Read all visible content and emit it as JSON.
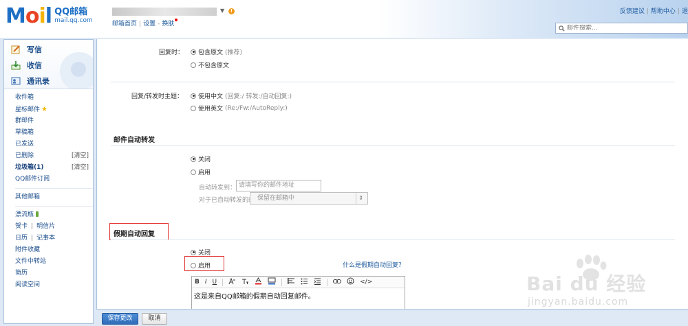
{
  "brand": {
    "logo": "MOil",
    "name_cn": "QQ邮箱",
    "domain": "mail.qq.com"
  },
  "header": {
    "nav": [
      "邮箱首页",
      "设置",
      "换肤"
    ],
    "right_links": [
      "反馈建议",
      "帮助中心",
      "退"
    ],
    "search_placeholder": "邮件搜索..."
  },
  "sidebar": {
    "actions": [
      {
        "label": "写信",
        "icon": "pencil-icon"
      },
      {
        "label": "收信",
        "icon": "inbox-download-icon"
      },
      {
        "label": "通讯录",
        "icon": "contacts-icon"
      }
    ],
    "folders": {
      "inbox": "收件箱",
      "starred": "星标邮件",
      "group": "群邮件",
      "drafts": "草稿箱",
      "sent": "已发送",
      "deleted": "已删除",
      "deleted_clear": "[清空]",
      "spam": "垃圾箱(1)",
      "spam_clear": "[清空]",
      "subscriptions": "QQ邮件订阅",
      "other": "其他邮箱",
      "drift_bottle": "漂流瓶",
      "card": "贺卡",
      "postcard": "明信片",
      "calendar": "日历",
      "notebook": "记事本",
      "attachments": "附件收藏",
      "transfer": "文件中转站",
      "resume": "简历",
      "reading": "阅读空间"
    }
  },
  "settings": {
    "reply": {
      "label": "回复时：",
      "options": [
        {
          "label": "包含原文",
          "hint": "(推荐)",
          "selected": true
        },
        {
          "label": "不包含原文",
          "hint": "",
          "selected": false
        }
      ]
    },
    "reply_subject": {
      "label": "回复/转发时主题：",
      "options": [
        {
          "label": "使用中文",
          "hint": "(回复:/ 转发:/自动回复:)",
          "selected": true
        },
        {
          "label": "使用英文",
          "hint": "(Re:/Fw:/AutoReply:)",
          "selected": false
        }
      ]
    },
    "auto_forward": {
      "title": "邮件自动转发",
      "options": [
        {
          "label": "关闭",
          "selected": true
        },
        {
          "label": "启用",
          "selected": false
        }
      ],
      "forward_to_label": "自动转发到：",
      "forward_to_placeholder": "请填写你的邮件地址",
      "forwarded_mail_label": "对于已自动转发的邮件，",
      "forwarded_mail_value": "保留在邮箱中"
    },
    "vacation_reply": {
      "title": "假期自动回复",
      "options": [
        {
          "label": "关闭",
          "selected": true
        },
        {
          "label": "启用",
          "selected": false
        }
      ],
      "help_link": "什么是假期自动回复？",
      "editor_toolbar": [
        "B",
        "I",
        "U"
      ],
      "editor_content": "这是来自QQ邮箱的假期自动回复邮件。"
    }
  },
  "footer": {
    "save": "保存更改",
    "cancel": "取消"
  },
  "watermark": {
    "brand": "Bai du 经验",
    "url": "jingyan.baidu.com"
  },
  "colors": {
    "accent": "#1d6fc4",
    "highlight": "#e23333",
    "primary_button": "#2f6cb8"
  }
}
